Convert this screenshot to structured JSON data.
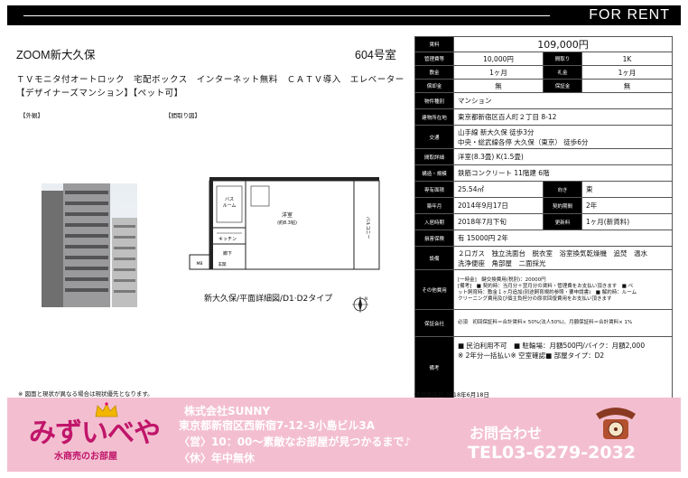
{
  "header": {
    "label": "FOR RENT"
  },
  "property": {
    "name": "ZOOM新大久保",
    "room": "604号室",
    "features_line1": "ＴＶモニタ付オートロック　宅配ボックス　インターネット無料　ＣＡＴＶ導入　エレベーター",
    "features_line2": "【デザイナーズマンション】【ペット可】"
  },
  "labels": {
    "exterior": "【外観】",
    "floorplan": "【間取り図】"
  },
  "floorplan": {
    "caption": "新大久保/平面詳細図/D1·D2タイプ",
    "rooms": {
      "youshitsu": "洋室",
      "youshitsu_size": "(約8.3帖)",
      "bath": "バス",
      "bath2": "ルーム",
      "kitchen": "キッチン",
      "hall": "廊下",
      "balcony": "バルコニー",
      "mb": "MB",
      "genkan": "玄関"
    }
  },
  "compass": {
    "north": "N"
  },
  "note": "※ 図面と現状が異なる場合は現状優先となります。",
  "specs": {
    "rent_label": "賃料",
    "rent": "109,000円",
    "mgmt_label": "管理費等",
    "mgmt": "10,000円",
    "layout_label": "間取り",
    "layout": "1K",
    "deposit_label": "敷金",
    "deposit": "1ヶ月",
    "key_label": "礼金",
    "key": "1ヶ月",
    "amort_label": "償却金",
    "amort": "無",
    "guarantee_label": "保証金",
    "guarantee": "無",
    "type_label": "物件種別",
    "type": "マンション",
    "address_label": "建物所在地",
    "address": "東京都新宿区百人町２丁目 8-12",
    "traffic_label": "交通",
    "traffic1": "山手線 新大久保 徒歩3分",
    "traffic2": "中央・総武線各停 大久保（東京） 徒歩6分",
    "detail_label": "間取詳細",
    "detail": "洋室(8.3畳) K(1.5畳)",
    "structure_label": "構造・規模",
    "structure": "鉄筋コンクリート 11階建 6階",
    "area_label": "専有面積",
    "area": "25.54㎡",
    "direction_label": "向き",
    "direction": "東",
    "built_label": "築年月",
    "built": "2014年9月17日",
    "contract_label": "契約期間",
    "contract": "2年",
    "movein_label": "入居時期",
    "movein": "2018年7月下旬",
    "renewal_label": "更新料",
    "renewal": "1ヶ月(新賃料)",
    "insurance_label": "損害保険",
    "insurance": "有 15000円 2年",
    "facility_label": "設備",
    "facility1": "２口ガス　独立洗面台　脱衣室　浴室換気乾燥機　追焚　温水",
    "facility2": "洗浄便座　角部屋　二面採光",
    "other_label": "その他費用",
    "other1": "[一時金]　鍵交換費用(税別)：20000円",
    "other2": "[備考]　■ 契約時：当月分＋翌月分の賃料・管理費をお支払い頂きます　■ ペ",
    "other3": "ット飼育時：敷金１ヶ月追加(別途飼育規約参照・要申請書)　■ 解約時：ルーム",
    "other4": "クリーニング費用及び個主負担分の原状回復費用をお支払い頂きます",
    "guarantee_co_label": "保証会社",
    "guarantee_co": "必須　初回保証料＝合計賃料× 50%(法人50%)、月額保証料＝合計賃料× 1%",
    "remarks_label": "備考",
    "remarks1": "■ 民泊利用不可　■ 駐輪場：月額500円/バイク：月額2,000",
    "remarks2": "※ 2年分一括払い※ 空室確認■ 部屋タイプ：D2",
    "updated": "情報更新日 2018年6月18日"
  },
  "banner": {
    "logo": "みずいべや",
    "logo_sub": "水商売のお部屋",
    "company": "株式会社SUNNY",
    "address": "東京都新宿区西新宿7-12-3小島ビル3A",
    "hours": "〈営〉10：00～素敵なお部屋が見つかるまで♪",
    "holiday": "〈休〉年中無休",
    "contact": "お問合わせ",
    "tel": "TEL03-6279-2032"
  }
}
